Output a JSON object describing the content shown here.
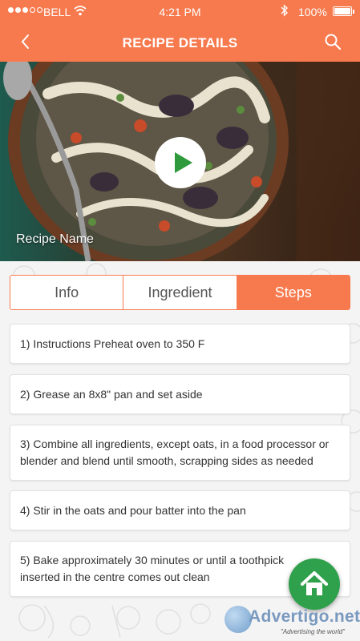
{
  "status_bar": {
    "carrier": "BELL",
    "time": "4:21 PM",
    "battery": "100%"
  },
  "nav": {
    "title": "RECIPE DETAILS",
    "back_icon": "chevron-left-icon",
    "search_icon": "search-icon"
  },
  "hero": {
    "recipe_name": "Recipe Name",
    "play_icon": "play-icon"
  },
  "tabs": [
    {
      "label": "Info",
      "active": false
    },
    {
      "label": "Ingredient",
      "active": false
    },
    {
      "label": "Steps",
      "active": true
    }
  ],
  "steps": [
    "1) Instructions Preheat oven to 350 F",
    "2) Grease an 8x8\" pan and set aside",
    "3) Combine all ingredients, except oats, in a food processor or blender and blend until smooth, scrapping sides as needed",
    "4) Stir in the oats and pour batter into the pan",
    "5) Bake approximately 30 minutes or until a toothpick inserted in the centre comes out clean"
  ],
  "fab": {
    "icon": "home-icon"
  },
  "watermark": {
    "brand": "Advertigo.net",
    "tagline": "\"Advertising the world\""
  },
  "colors": {
    "accent": "#f77a4e",
    "fab": "#2fa04b",
    "play": "#2f9a3c"
  }
}
